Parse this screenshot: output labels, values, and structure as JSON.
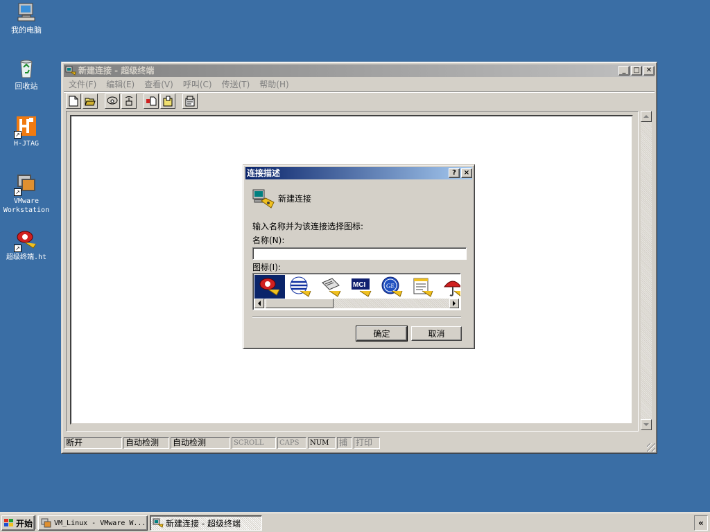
{
  "desktop": {
    "icons": [
      {
        "label": "我的电脑",
        "icon": "my-computer-icon"
      },
      {
        "label": "回收站",
        "icon": "recycle-bin-icon"
      },
      {
        "label": "H-JTAG",
        "icon": "hjtag-icon"
      },
      {
        "label_line1": "VMware",
        "label_line2": "Workstation",
        "icon": "vmware-icon"
      },
      {
        "label": "超级终端.ht",
        "icon": "hyperterminal-phone-icon"
      }
    ]
  },
  "main_window": {
    "title": "新建连接 - 超级终端",
    "menu": [
      "文件(F)",
      "编辑(E)",
      "查看(V)",
      "呼叫(C)",
      "传送(T)",
      "帮助(H)"
    ],
    "status": {
      "connection": "断开",
      "detect1": "自动检测",
      "detect2": "自动检测",
      "scroll": "SCROLL",
      "caps": "CAPS",
      "num": "NUM",
      "capture": "捕",
      "print": "打印"
    }
  },
  "dialog": {
    "title": "连接描述",
    "help_button": "?",
    "close_button": "×",
    "header_text": "新建连接",
    "instruction": "输入名称并为该连接选择图标:",
    "name_label": "名称(N):",
    "name_value": "",
    "icon_label": "图标(I):",
    "icon_options": [
      "red-phone-icon",
      "globe-phone-icon",
      "fax-phone-icon",
      "mci-phone-icon",
      "ge-phone-icon",
      "notepad-phone-icon",
      "umbrella-phone-icon"
    ],
    "ok_label": "确定",
    "cancel_label": "取消"
  },
  "taskbar": {
    "start_label": "开始",
    "tasks": [
      {
        "label": "VM_Linux - VMware W...",
        "active": false
      },
      {
        "label": "新建连接 - 超级终端",
        "active": true
      }
    ],
    "tray_label": "«"
  },
  "colors": {
    "desktop": "#3a6ea5",
    "active_title_start": "#0a246a",
    "active_title_end": "#a6caf0",
    "inactive_title_start": "#808080",
    "face": "#d4d0c8"
  }
}
